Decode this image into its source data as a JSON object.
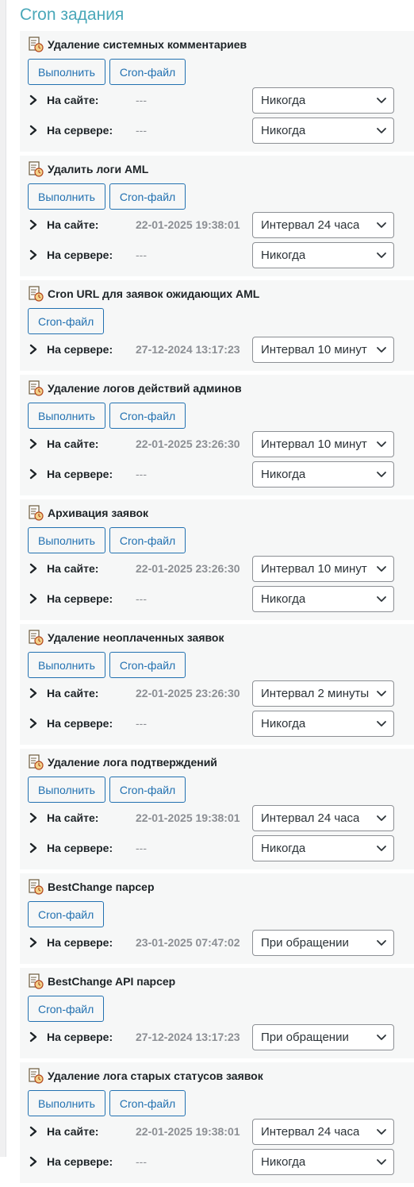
{
  "page": {
    "title": "Cron задания"
  },
  "labels": {
    "site": "На сайте:",
    "server": "На сервере:",
    "run": "Выполнить",
    "cron_file": "Cron-файл"
  },
  "jobs": [
    {
      "title": "Удаление системных комментариев",
      "run": true,
      "site": {
        "time": "---",
        "interval": "Никогда"
      },
      "server": {
        "time": "---",
        "interval": "Никогда"
      }
    },
    {
      "title": "Удалить логи AML",
      "run": true,
      "site": {
        "time": "22-01-2025 19:38:01",
        "interval": "Интервал 24 часа"
      },
      "server": {
        "time": "---",
        "interval": "Никогда"
      }
    },
    {
      "title": "Cron URL для заявок ожидающих AML",
      "run": false,
      "server": {
        "time": "27-12-2024 13:17:23",
        "interval": "Интервал 10 минут"
      }
    },
    {
      "title": "Удаление логов действий админов",
      "run": true,
      "site": {
        "time": "22-01-2025 23:26:30",
        "interval": "Интервал 10 минут"
      },
      "server": {
        "time": "---",
        "interval": "Никогда"
      }
    },
    {
      "title": "Архивация заявок",
      "run": true,
      "site": {
        "time": "22-01-2025 23:26:30",
        "interval": "Интервал 10 минут"
      },
      "server": {
        "time": "---",
        "interval": "Никогда"
      }
    },
    {
      "title": "Удаление неоплаченных заявок",
      "run": true,
      "site": {
        "time": "22-01-2025 23:26:30",
        "interval": "Интервал 2 минуты"
      },
      "server": {
        "time": "---",
        "interval": "Никогда"
      }
    },
    {
      "title": "Удаление лога подтверждений",
      "run": true,
      "site": {
        "time": "22-01-2025 19:38:01",
        "interval": "Интервал 24 часа"
      },
      "server": {
        "time": "---",
        "interval": "Никогда"
      }
    },
    {
      "title": "BestChange парсер",
      "run": false,
      "server": {
        "time": "23-01-2025 07:47:02",
        "interval": "При обращении"
      }
    },
    {
      "title": "BestChange API парсер",
      "run": false,
      "server": {
        "time": "27-12-2024 13:17:23",
        "interval": "При обращении"
      }
    },
    {
      "title": "Удаление лога старых статусов заявок",
      "run": true,
      "site": {
        "time": "22-01-2025 19:38:01",
        "interval": "Интервал 24 часа"
      },
      "server": {
        "time": "---",
        "interval": "Никогда"
      }
    }
  ],
  "colors": {
    "accent": "#2271b1",
    "title": "#4aa8b9",
    "muted": "#8c8f94",
    "panel": "#f6f7f7"
  },
  "icons": {
    "job": "clock-document-icon",
    "row": "chevron-right-icon",
    "select": "chevron-down-icon"
  }
}
